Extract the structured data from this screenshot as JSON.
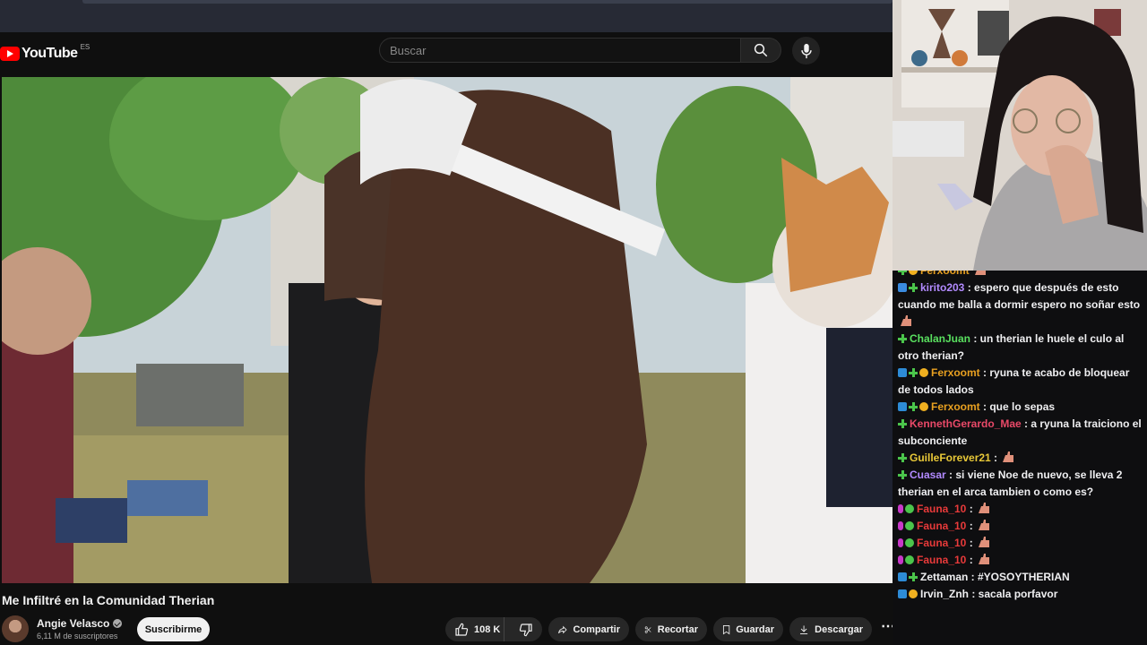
{
  "youtube": {
    "logo_text": "YouTube",
    "region": "ES",
    "search_placeholder": "Buscar",
    "video_title": "Me Infiltré en la Comunidad Therian",
    "channel_name": "Angie Velasco",
    "subscribers": "6,11 M de suscriptores",
    "subscribe_label": "Suscribirme",
    "like_count": "108 K",
    "share_label": "Compartir",
    "clip_label": "Recortar",
    "save_label": "Guardar",
    "download_label": "Descargar",
    "more_label": "⋯"
  },
  "chat": {
    "messages": [
      {
        "user": "Ferxoomt",
        "color": "#e8a020",
        "text": "",
        "badges": [
          "plus",
          "coin"
        ],
        "emote": true,
        "partial": true
      },
      {
        "user": "kirito203",
        "color": "#b28aff",
        "text": ": espero que después de esto cuando me balla a dormir espero no soñar esto",
        "badges": [
          "cube",
          "plus"
        ],
        "emote": true
      },
      {
        "user": "ChalanJuan",
        "color": "#59e05f",
        "text": ": un therian le huele el culo al otro therian?",
        "badges": [
          "plus"
        ]
      },
      {
        "user": "Ferxoomt",
        "color": "#e8a020",
        "text": ": ryuna te acabo de bloquear de todos lados",
        "badges": [
          "prime",
          "plus",
          "coin"
        ]
      },
      {
        "user": "Ferxoomt",
        "color": "#e8a020",
        "text": ": que lo sepas",
        "badges": [
          "prime",
          "plus",
          "coin"
        ]
      },
      {
        "user": "KennethGerardo_Mae",
        "color": "#e94968",
        "text": ": a ryuna la traiciono el subconciente",
        "badges": [
          "plus"
        ]
      },
      {
        "user": "GuilleForever21",
        "color": "#e8c838",
        "text": ": ",
        "badges": [
          "plus"
        ],
        "emote": true
      },
      {
        "user": "Cuasar",
        "color": "#b28aff",
        "text": ": si viene Noe de nuevo, se lleva 2 therian en el arca tambien o como es?",
        "badges": [
          "plus"
        ]
      },
      {
        "user": "Fauna_10",
        "color": "#e83a3a",
        "text": ": ",
        "badges": [
          "mic",
          "dot"
        ],
        "emote": true
      },
      {
        "user": "Fauna_10",
        "color": "#e83a3a",
        "text": ": ",
        "badges": [
          "mic",
          "dot"
        ],
        "emote": true
      },
      {
        "user": "Fauna_10",
        "color": "#e83a3a",
        "text": ": ",
        "badges": [
          "mic",
          "dot"
        ],
        "emote": true
      },
      {
        "user": "Fauna_10",
        "color": "#e83a3a",
        "text": ": ",
        "badges": [
          "mic",
          "dot"
        ],
        "emote": true
      },
      {
        "user": "Zettaman",
        "color": "#efeff1",
        "text": ": #YOSOYTHERIAN",
        "badges": [
          "prime",
          "plus"
        ]
      },
      {
        "user": "Irvin_Znh",
        "color": "#efeff1",
        "text": ": sacala porfavor",
        "badges": [
          "prime",
          "coin"
        ]
      }
    ]
  }
}
